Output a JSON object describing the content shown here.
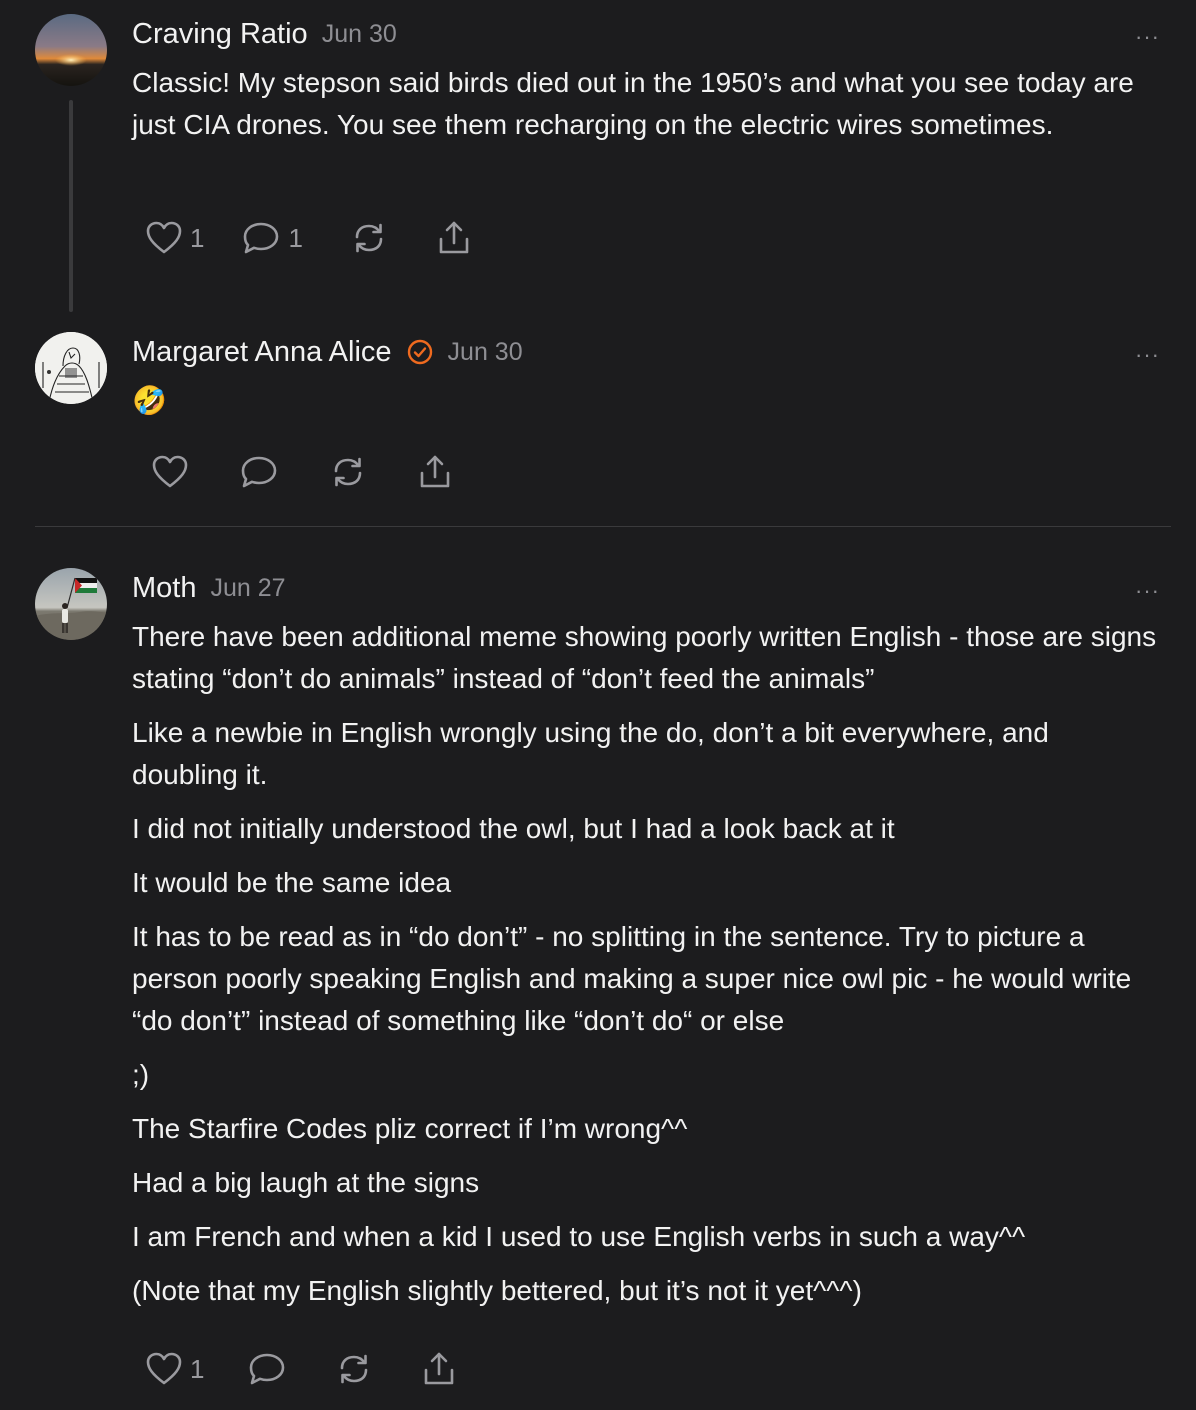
{
  "comments": [
    {
      "author": "Craving Ratio",
      "date": "Jun 30",
      "more": "···",
      "paragraphs": [
        "Classic! My stepson said birds died out in the 1950’s and what you see today are just CIA drones. You see them recharging on the electric wires sometimes."
      ],
      "like_count": "1",
      "reply_count": "1"
    },
    {
      "author": "Margaret Anna Alice",
      "date": "Jun 30",
      "more": "···",
      "emoji": "🤣",
      "verified_color": "#ef6a1f"
    },
    {
      "author": "Moth",
      "date": "Jun 27",
      "more": "···",
      "paragraphs": [
        "There have been additional meme showing poorly written English - those are signs stating “don’t do animals” instead of “don’t feed the animals”",
        "Like a newbie in English wrongly using the do, don’t a bit everywhere, and doubling it.",
        "I did not initially understood the owl, but I had a look back at it",
        "It would be the same idea",
        "It has to be read as in “do don’t” - no splitting in the sentence. Try to picture a person poorly speaking English and making a super nice owl pic - he would write “do don’t” instead of something like “don’t do“ or else",
        ";)",
        "The Starfire Codes pliz correct if I’m wrong^^",
        "Had a big laugh at the signs",
        "I am French and when a kid I used to use English verbs in such a way^^",
        "(Note that my English slightly bettered, but it’s not it yet^^^)"
      ],
      "like_count": "1"
    }
  ],
  "colors": {
    "background": "#1c1c1e",
    "text": "#f2f2f2",
    "muted": "#8e8e93",
    "icon": "#9a9a9f",
    "accent": "#ef6a1f"
  },
  "icons": [
    "heart-icon",
    "comment-icon",
    "restack-icon",
    "share-icon",
    "more-icon",
    "verified-icon"
  ]
}
